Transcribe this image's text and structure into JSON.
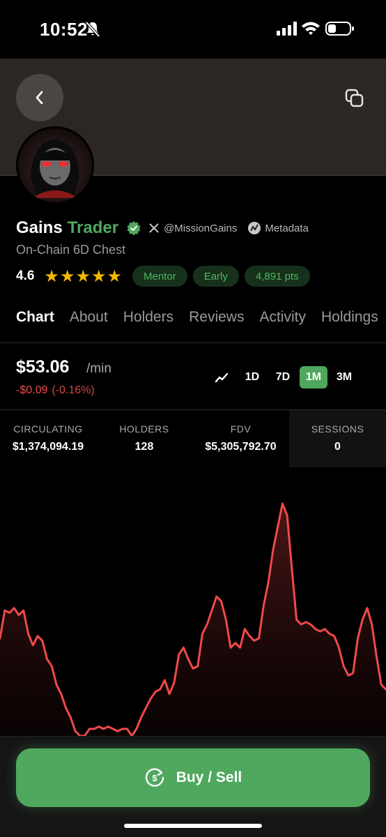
{
  "status_bar": {
    "time": "10:52"
  },
  "profile": {
    "name": "Gains",
    "name_accent": "Trader",
    "x_handle": "@MissionGains",
    "metadata_label": "Metadata",
    "subtitle": "On-Chain 6D Chest",
    "rating": "4.6",
    "stars": "★★★★★",
    "badges": [
      "Mentor",
      "Early",
      "4,891 pts"
    ]
  },
  "tabs": [
    "Chart",
    "About",
    "Holders",
    "Reviews",
    "Activity",
    "Holdings"
  ],
  "price": {
    "value": "$53.06",
    "unit": "/min",
    "change": "-$0.09",
    "change_pct": "(-0.16%)"
  },
  "ranges": [
    "1D",
    "7D",
    "1M",
    "3M"
  ],
  "selected_range": "1M",
  "stats": [
    {
      "label": "CIRCULATING",
      "value": "$1,374,094.19"
    },
    {
      "label": "HOLDERS",
      "value": "128"
    },
    {
      "label": "FDV",
      "value": "$5,305,792.70"
    },
    {
      "label": "SESSIONS",
      "value": "0"
    }
  ],
  "chart_data": {
    "type": "area",
    "series": [
      {
        "values": [
          42,
          54,
          53,
          55,
          52,
          54,
          44,
          39,
          43,
          41,
          33,
          30,
          22,
          18,
          12,
          8,
          2,
          0,
          0,
          3,
          3,
          4,
          3,
          4,
          3,
          2,
          3,
          3,
          0,
          3,
          8,
          12,
          16,
          19,
          20,
          24,
          18,
          23,
          35,
          38,
          33,
          29,
          30,
          44,
          48,
          54,
          60,
          58,
          50,
          38,
          40,
          38,
          46,
          43,
          41,
          42,
          56,
          66,
          80,
          90,
          100,
          95,
          72,
          50,
          48,
          49,
          48,
          46,
          45,
          46,
          44,
          43,
          38,
          30,
          26,
          27,
          42,
          50,
          55,
          48,
          34,
          22,
          20
        ]
      }
    ]
  },
  "colors": {
    "accent_green": "#4fa85e",
    "negative_red": "#ef4a4a",
    "star_gold": "#f5b800"
  },
  "actions": {
    "buy_sell": "Buy / Sell"
  }
}
